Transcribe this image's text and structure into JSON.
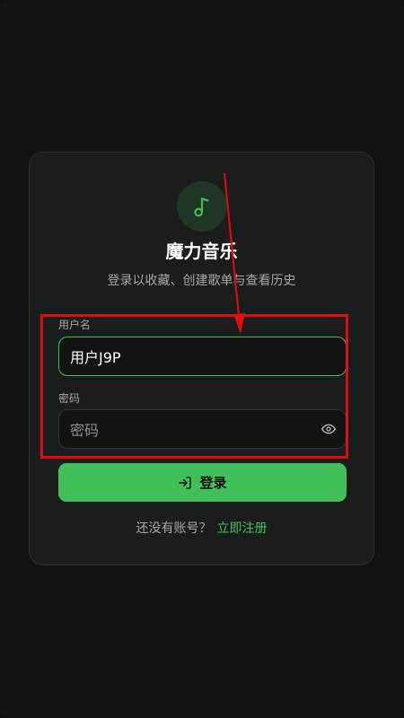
{
  "app": {
    "title": "魔力音乐",
    "subtitle": "登录以收藏、创建歌单与查看历史",
    "logo_icon": "music-note-icon"
  },
  "form": {
    "username": {
      "label": "用户名",
      "value": "用户J9P",
      "focused": true
    },
    "password": {
      "label": "密码",
      "placeholder": "密码",
      "value": "",
      "toggle_icon": "eye-icon"
    },
    "login_button": {
      "label": "登录",
      "icon": "login-icon"
    }
  },
  "footer": {
    "prompt": "还没有账号？",
    "register_link": "立即注册"
  },
  "colors": {
    "accent": "#41c059",
    "annotation": "#e40b0b",
    "background": "#111312",
    "card": "#1b1d1c"
  }
}
